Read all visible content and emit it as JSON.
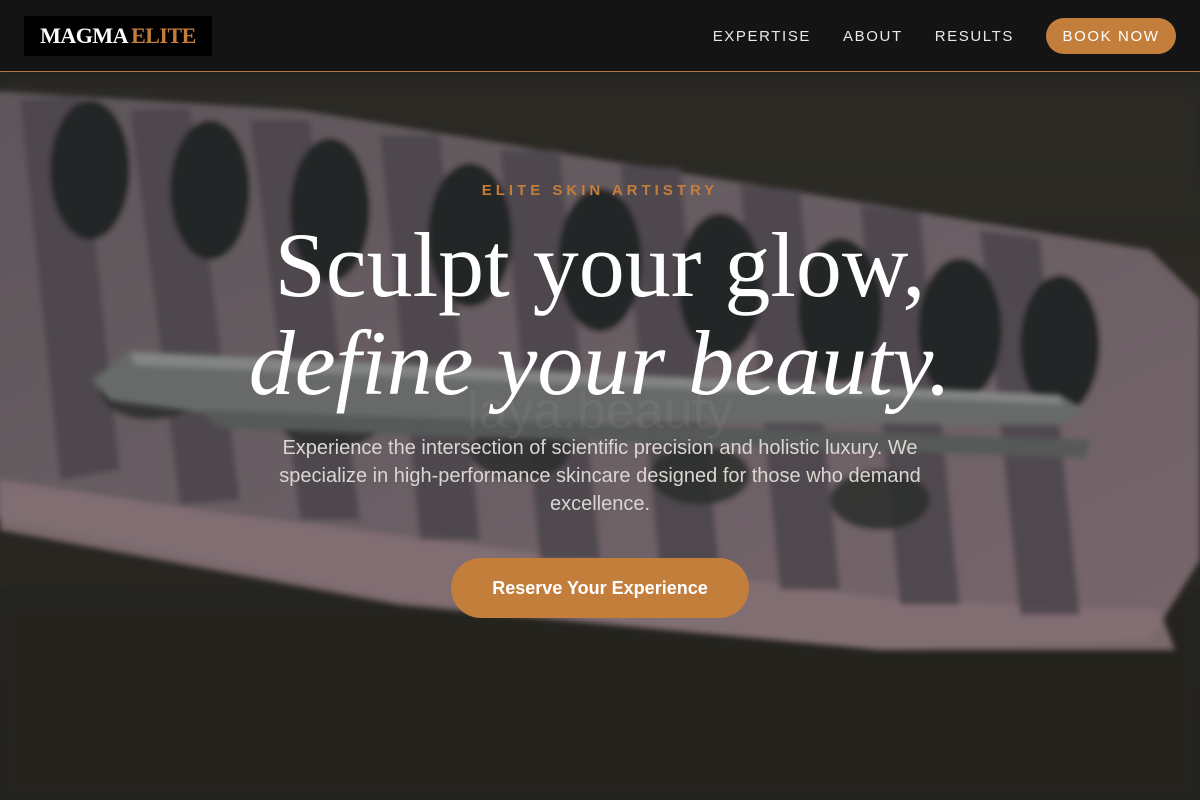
{
  "brand": {
    "logo_primary": "MAGMA",
    "logo_accent": "ELITE",
    "accent_color": "#c47e3c"
  },
  "nav": {
    "items": [
      {
        "label": "EXPERTISE"
      },
      {
        "label": "ABOUT"
      },
      {
        "label": "RESULTS"
      }
    ],
    "cta_label": "BOOK NOW"
  },
  "hero": {
    "eyebrow": "ELITE SKIN ARTISTRY",
    "headline_line1": "Sculpt your glow,",
    "headline_line2": "define your beauty.",
    "subtext": "Experience the intersection of scientific precision and holistic luxury. We specialize in high-performance skincare designed for those who demand excellence.",
    "cta_label": "Reserve Your Experience",
    "background_image": "eyelash-extension-tray-with-tweezers",
    "background_watermark": "laya.beauty"
  }
}
